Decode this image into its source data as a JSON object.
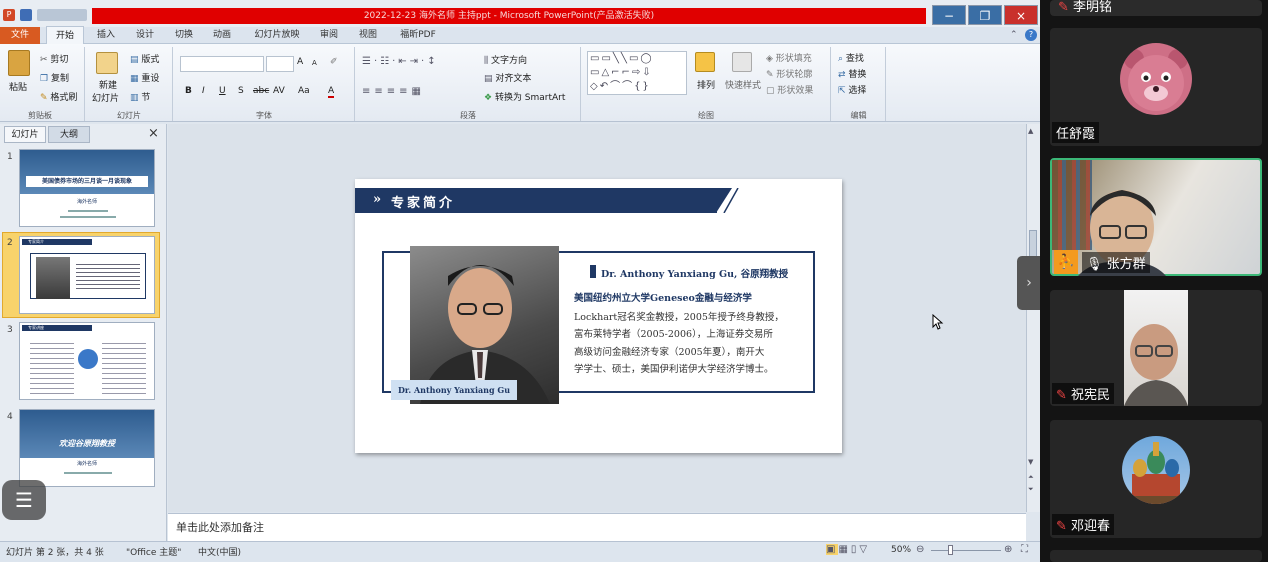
{
  "window": {
    "title": "2022-12-23 海外名师 主持ppt  -  Microsoft PowerPoint(产品激活失败)",
    "controls": {
      "minimize": "−",
      "restore": "❐",
      "close": "×"
    }
  },
  "ribbon_tabs": [
    "文件",
    "开始",
    "插入",
    "设计",
    "切换",
    "动画",
    "幻灯片放映",
    "审阅",
    "视图",
    "福昕PDF"
  ],
  "ribbon": {
    "clipboard": {
      "paste": "粘贴",
      "cut": "剪切",
      "copy": "复制",
      "format_painter": "格式刷",
      "label": "剪贴板"
    },
    "slides": {
      "new_slide": "新建",
      "new_slide2": "幻灯片",
      "layout": "版式",
      "reset": "重设",
      "section": "节",
      "label": "幻灯片"
    },
    "font": {
      "grow": "A",
      "shrink": "A",
      "bold": "B",
      "italic": "I",
      "underline": "U",
      "strike": "S",
      "abc": "abc",
      "spacing": "AV",
      "case": "Aa",
      "color": "A",
      "label": "字体"
    },
    "paragraph": {
      "text_direction": "文字方向",
      "align_text": "对齐文本",
      "smartart": "转换为 SmartArt",
      "label": "段落"
    },
    "drawing": {
      "arrange": "排列",
      "quick_styles": "快速样式",
      "fill": "形状填充",
      "outline": "形状轮廓",
      "effects": "形状效果",
      "label": "绘图"
    },
    "editing": {
      "find": "查找",
      "replace": "替换",
      "select": "选择",
      "label": "编辑"
    }
  },
  "left_pane": {
    "tabs": [
      "幻灯片",
      "大纲"
    ],
    "close": "×",
    "slides": [
      {
        "num": "1",
        "title": "美国债券市场的三月谈一月谈现象",
        "subtitle": "海外名师"
      },
      {
        "num": "2",
        "title": "专家简介"
      },
      {
        "num": "3",
        "title": "专家讲座"
      },
      {
        "num": "4",
        "title": "欢迎谷原翔教授",
        "subtitle": "海外名师"
      }
    ]
  },
  "slide": {
    "header": "专家简介",
    "header_arrow": "»",
    "photo_caption": "Dr. Anthony Yanxiang Gu",
    "bio_lines": [
      "Dr. Anthony Yanxiang Gu, 谷原翔教授",
      "美国纽约州立大学Geneseo金融与经济学",
      "Lockhart冠名奖金教授，2005年授予终身教授，",
      "富布莱特学者（2005-2006），上海证券交易所",
      "高级访问金融经济专家（2005年夏），南开大",
      "学学士、硕士，美国伊利诺伊大学经济学博士。"
    ]
  },
  "notes_placeholder": "单击此处添加备注",
  "status": {
    "slide_info": "幻灯片 第 2 张，共 4 张",
    "theme": "\"Office 主题\"",
    "language": "中文(中国)",
    "zoom": "50%",
    "zoom_level": 0.5
  },
  "participants": [
    {
      "name": "李明铭",
      "muted": true
    },
    {
      "name": "任舒霞",
      "muted": null
    },
    {
      "name": "张方群",
      "muted": false,
      "active": true
    },
    {
      "name": "祝宪民",
      "muted": true
    },
    {
      "name": "邓迎春",
      "muted": true
    }
  ],
  "colors": {
    "slide_navy": "#1f3864",
    "active_border": "#3cb878",
    "accent_orange": "#f39a1e"
  }
}
